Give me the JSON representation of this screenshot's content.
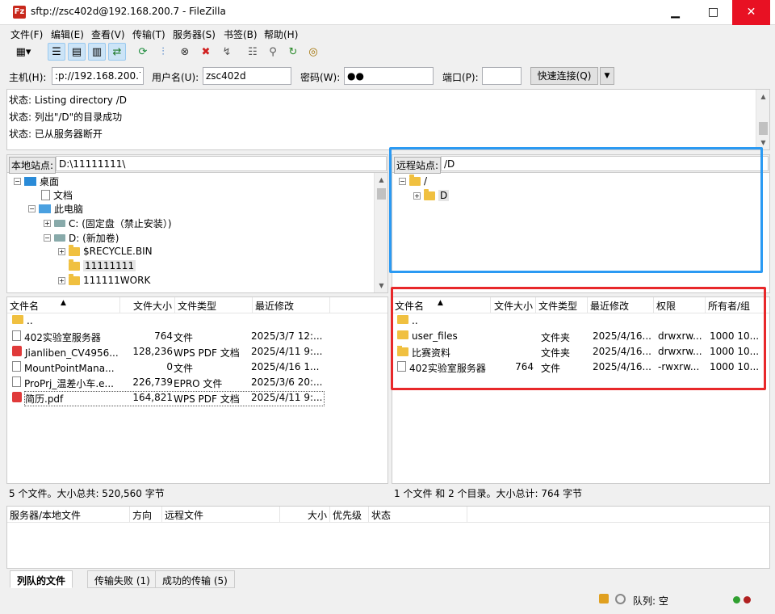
{
  "window": {
    "title": "sftp://zsc402d@192.168.200.7 - FileZilla",
    "app_icon": "Fz",
    "min": "▁",
    "max": "□",
    "close": "✕"
  },
  "menu": [
    "文件(F)",
    "编辑(E)",
    "查看(V)",
    "传输(T)",
    "服务器(S)",
    "书签(B)",
    "帮助(H)"
  ],
  "quickconnect": {
    "host_label": "主机(H):",
    "host_value": ":p://192.168.200.7",
    "user_label": "用户名(U):",
    "user_value": "zsc402d",
    "pass_label": "密码(W):",
    "pass_value": "●●",
    "port_label": "端口(P):",
    "port_value": "",
    "connect_button": "快速连接(Q)",
    "dropdown": "▼"
  },
  "log": [
    "状态: Listing directory /D",
    "状态: 列出\"/D\"的目录成功",
    "状态: 已从服务器断开"
  ],
  "local": {
    "site_label": "本地站点:",
    "path": "D:\\11111111\\",
    "tree": [
      {
        "exp": "−",
        "label": "桌面"
      },
      {
        "exp": "",
        "label": "文档"
      },
      {
        "exp": "−",
        "label": "此电脑"
      },
      {
        "exp": "+",
        "label": "C: (固定盘（禁止安装）)"
      },
      {
        "exp": "−",
        "label": "D: (新加卷)"
      },
      {
        "exp": "+",
        "label": "$RECYCLE.BIN"
      },
      {
        "exp": "",
        "label": "11111111"
      },
      {
        "exp": "+",
        "label": "111111WORK"
      }
    ],
    "columns": [
      "文件名",
      "文件大小",
      "文件类型",
      "最近修改"
    ],
    "files": [
      {
        "name": "..",
        "size": "",
        "type": "",
        "modified": ""
      },
      {
        "name": "402实验室服务器",
        "size": "764",
        "type": "文件",
        "modified": "2025/3/7 12:..."
      },
      {
        "name": "Jianliben_CV4956...",
        "size": "128,236",
        "type": "WPS PDF 文档",
        "modified": "2025/4/11 9:..."
      },
      {
        "name": "MountPointMana...",
        "size": "0",
        "type": "文件",
        "modified": "2025/4/16 1..."
      },
      {
        "name": "ProPrj_温差小车.e...",
        "size": "226,739",
        "type": "EPRO 文件",
        "modified": "2025/3/6 20:..."
      },
      {
        "name": "简历.pdf",
        "size": "164,821",
        "type": "WPS PDF 文档",
        "modified": "2025/4/11 9:..."
      }
    ],
    "status": "5 个文件。大小总共: 520,560 字节"
  },
  "remote": {
    "site_label": "远程站点:",
    "path": "/D",
    "tree": [
      {
        "exp": "−",
        "label": "/"
      },
      {
        "exp": "+",
        "label": "D"
      }
    ],
    "columns": [
      "文件名",
      "文件大小",
      "文件类型",
      "最近修改",
      "权限",
      "所有者/组"
    ],
    "files": [
      {
        "name": "..",
        "size": "",
        "type": "",
        "modified": "",
        "perm": "",
        "owner": ""
      },
      {
        "name": "user_files",
        "size": "",
        "type": "文件夹",
        "modified": "2025/4/16...",
        "perm": "drwxrw...",
        "owner": "1000 10..."
      },
      {
        "name": "比赛资料",
        "size": "",
        "type": "文件夹",
        "modified": "2025/4/16...",
        "perm": "drwxrw...",
        "owner": "1000 10..."
      },
      {
        "name": "402实验室服务器",
        "size": "764",
        "type": "文件",
        "modified": "2025/4/16...",
        "perm": "-rwxrw...",
        "owner": "1000 10..."
      }
    ],
    "status": "1 个文件 和 2 个目录。大小总计: 764 字节"
  },
  "queue": {
    "columns": [
      "服务器/本地文件",
      "方向",
      "远程文件",
      "大小",
      "优先级",
      "状态"
    ],
    "tabs": [
      "列队的文件",
      "传输失败 (1)",
      "成功的传输 (5)"
    ],
    "footer": "队列: 空"
  },
  "highlight_colors": {
    "blue": "#2b9af3",
    "red": "#e8282a"
  }
}
